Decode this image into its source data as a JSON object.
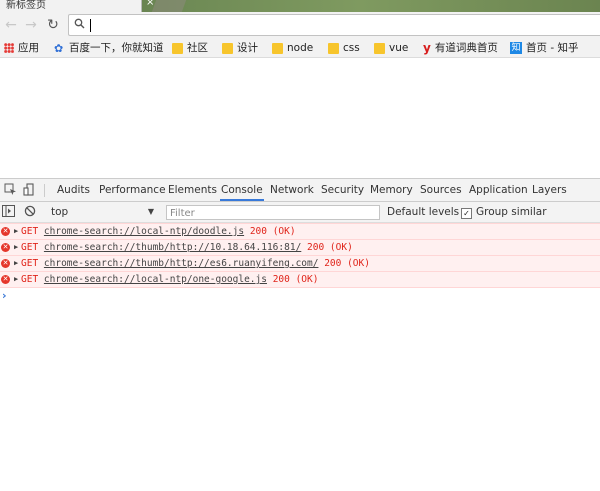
{
  "browser": {
    "tab": {
      "title": "新标签页",
      "close": "×"
    },
    "toolbar": {
      "back": "←",
      "forward": "→",
      "reload": "↻",
      "search_icon": "search-icon"
    },
    "bookmarks": [
      {
        "label": "应用",
        "icon": "apps-icon"
      },
      {
        "label": "百度一下，你就知道",
        "icon": "baidu-icon"
      },
      {
        "label": "社区",
        "icon": "folder-icon"
      },
      {
        "label": "设计",
        "icon": "folder-icon"
      },
      {
        "label": "node",
        "icon": "folder-icon"
      },
      {
        "label": "css",
        "icon": "folder-icon"
      },
      {
        "label": "vue",
        "icon": "folder-icon"
      },
      {
        "label": "有道词典首页",
        "icon": "youdao-icon"
      },
      {
        "label": "首页 - 知乎",
        "icon": "zhihu-icon"
      }
    ]
  },
  "devtools": {
    "tabs": [
      "Audits",
      "Performance",
      "Elements",
      "Console",
      "Network",
      "Security",
      "Memory",
      "Sources",
      "Application",
      "Layers"
    ],
    "active_tab": "Console",
    "filter_bar": {
      "context": "top",
      "filter_placeholder": "Filter",
      "levels": "Default levels",
      "group_similar": "Group similar",
      "group_similar_checked": true
    },
    "console_messages": [
      {
        "method": "GET",
        "url": "chrome-search://local-ntp/doodle.js",
        "status": "200 (OK)"
      },
      {
        "method": "GET",
        "url": "chrome-search://thumb/http://10.18.64.116:81/",
        "status": "200 (OK)"
      },
      {
        "method": "GET",
        "url": "chrome-search://thumb/http://es6.ruanyifeng.com/",
        "status": "200 (OK)"
      },
      {
        "method": "GET",
        "url": "chrome-search://local-ntp/one-google.js",
        "status": "200 (OK)"
      }
    ],
    "prompt": "›"
  },
  "colors": {
    "error_text": "#e0241a",
    "error_bg": "#fff0f0",
    "active_tab_underline": "#3879d9",
    "prompt": "#3a78d6"
  }
}
